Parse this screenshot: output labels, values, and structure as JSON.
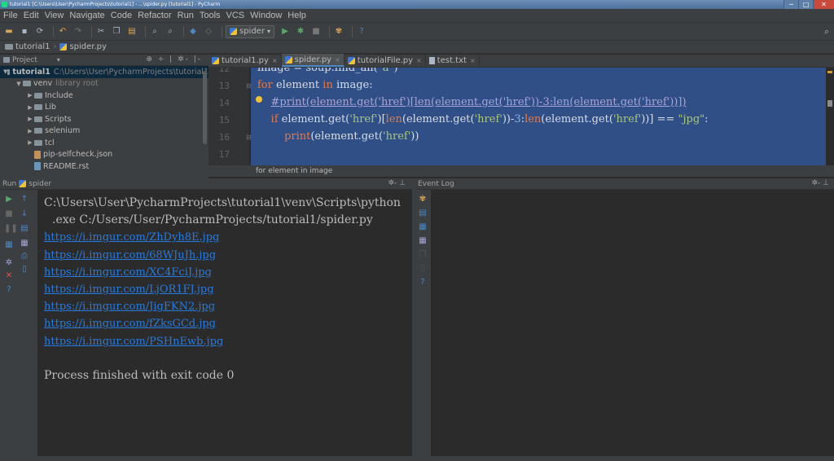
{
  "window": {
    "title": "tutorial1 [C:\\Users\\User\\PycharmProjects\\tutorial1] - ...\\spider.py [tutorial1] - PyCharm",
    "controls": [
      "─",
      "□",
      "✕"
    ]
  },
  "menu": [
    "File",
    "Edit",
    "View",
    "Navigate",
    "Code",
    "Refactor",
    "Run",
    "Tools",
    "VCS",
    "Window",
    "Help"
  ],
  "toolbar": {
    "run_config": "spider",
    "run_config_arrow": "▾",
    "icons": [
      "open-icon",
      "save-icon",
      "sync-icon",
      "undo-icon",
      "redo-icon",
      "cut-icon",
      "copy-icon",
      "paste-icon",
      "find-icon",
      "replace-icon",
      "back-icon",
      "forward-icon",
      "run-icon",
      "debug-icon",
      "stop-icon",
      "vcs-icon",
      "help-icon",
      "search-icon"
    ]
  },
  "navbar": {
    "project": "tutorial1",
    "file": "spider.py"
  },
  "project_pane": {
    "header": "Project",
    "header_arrow": "▾",
    "tree": [
      {
        "label": "tutorial1",
        "suffix": "C:\\Users\\User\\PycharmProjects\\tutorial1",
        "type": "folder",
        "expanded": true,
        "selected": true,
        "depth": 0
      },
      {
        "label": "venv",
        "suffix": "library root",
        "type": "folder",
        "expanded": true,
        "selected": false,
        "depth": 1
      },
      {
        "label": "Include",
        "suffix": "",
        "type": "folder",
        "expanded": false,
        "selected": false,
        "depth": 2
      },
      {
        "label": "Lib",
        "suffix": "",
        "type": "folder",
        "expanded": false,
        "selected": false,
        "depth": 2
      },
      {
        "label": "Scripts",
        "suffix": "",
        "type": "folder",
        "expanded": false,
        "selected": false,
        "depth": 2
      },
      {
        "label": "selenium",
        "suffix": "",
        "type": "folder",
        "expanded": false,
        "selected": false,
        "depth": 2
      },
      {
        "label": "tcl",
        "suffix": "",
        "type": "folder",
        "expanded": false,
        "selected": false,
        "depth": 2
      },
      {
        "label": "pip-selfcheck.json",
        "suffix": "",
        "type": "json",
        "expanded": false,
        "selected": false,
        "depth": 2
      },
      {
        "label": "README.rst",
        "suffix": "",
        "type": "rst",
        "expanded": false,
        "selected": false,
        "depth": 2
      }
    ]
  },
  "editor_tabs": [
    {
      "label": "tutorial1.py",
      "active": false,
      "icon": "python"
    },
    {
      "label": "spider.py",
      "active": true,
      "icon": "python"
    },
    {
      "label": "tutorialFile.py",
      "active": false,
      "icon": "python"
    },
    {
      "label": "test.txt",
      "active": false,
      "icon": "text"
    }
  ],
  "editor": {
    "line_numbers": [
      "12",
      "13",
      "14",
      "15",
      "16",
      "17"
    ],
    "lines": [
      [
        {
          "t": "image = soup.find_all(",
          "c": ""
        },
        {
          "t": "\"a\"",
          "c": "str"
        },
        {
          "t": ")",
          "c": ""
        }
      ],
      [
        {
          "t": "for",
          "c": "kw"
        },
        {
          "t": " element ",
          "c": ""
        },
        {
          "t": "in",
          "c": "kw"
        },
        {
          "t": " image:",
          "c": ""
        }
      ],
      [
        {
          "t": "    ",
          "c": ""
        },
        {
          "t": "#print(element.get('href')[len(element.get('href'))-3:len(element.get('href'))])",
          "c": "cmt"
        }
      ],
      [
        {
          "t": "    ",
          "c": ""
        },
        {
          "t": "if",
          "c": "kw"
        },
        {
          "t": " element.get(",
          "c": ""
        },
        {
          "t": "'href'",
          "c": "str"
        },
        {
          "t": ")[",
          "c": ""
        },
        {
          "t": "len",
          "c": "kw"
        },
        {
          "t": "(element.get(",
          "c": ""
        },
        {
          "t": "'href'",
          "c": "str"
        },
        {
          "t": "))-",
          "c": ""
        },
        {
          "t": "3",
          "c": "num"
        },
        {
          "t": ":",
          "c": ""
        },
        {
          "t": "len",
          "c": "kw"
        },
        {
          "t": "(element.get(",
          "c": ""
        },
        {
          "t": "'href'",
          "c": "str"
        },
        {
          "t": "))] == ",
          "c": ""
        },
        {
          "t": "\"jpg\"",
          "c": "str"
        },
        {
          "t": ":",
          "c": ""
        }
      ],
      [
        {
          "t": "        ",
          "c": ""
        },
        {
          "t": "print",
          "c": "kw"
        },
        {
          "t": "(element.get(",
          "c": ""
        },
        {
          "t": "'href'",
          "c": "str"
        },
        {
          "t": "))",
          "c": ""
        }
      ],
      []
    ],
    "breadcrumb": "for element in image"
  },
  "run_panel": {
    "label": "Run",
    "config": "spider",
    "header_icons": "✲- ⊥",
    "console": [
      {
        "text": "C:\\Users\\User\\PycharmProjects\\tutorial1\\venv\\Scripts\\python",
        "kind": "plain"
      },
      {
        "text": ".exe C:/Users/User/PycharmProjects/tutorial1/spider.py",
        "kind": "indent"
      },
      {
        "text": "https://i.imgur.com/ZhDyh8E.jpg",
        "kind": "link"
      },
      {
        "text": "https://i.imgur.com/68WJuJh.jpg",
        "kind": "link"
      },
      {
        "text": "https://i.imgur.com/XC4FciJ.jpg",
        "kind": "link"
      },
      {
        "text": "https://i.imgur.com/LjOR1FJ.jpg",
        "kind": "link"
      },
      {
        "text": "https://i.imgur.com/JigFKN2.jpg",
        "kind": "link"
      },
      {
        "text": "https://i.imgur.com/fZksGCd.jpg",
        "kind": "link"
      },
      {
        "text": "https://i.imgur.com/PSHnEwb.jpg",
        "kind": "link"
      },
      {
        "text": "",
        "kind": "plain"
      },
      {
        "text": "Process finished with exit code 0",
        "kind": "plain"
      }
    ]
  },
  "event_log": {
    "label": "Event Log",
    "header_icons": "✲- ⊥"
  },
  "colors": {
    "selection": "#2f4f86",
    "link": "#287bde",
    "keyword": "#e27a4b",
    "string": "#a8c67e"
  }
}
